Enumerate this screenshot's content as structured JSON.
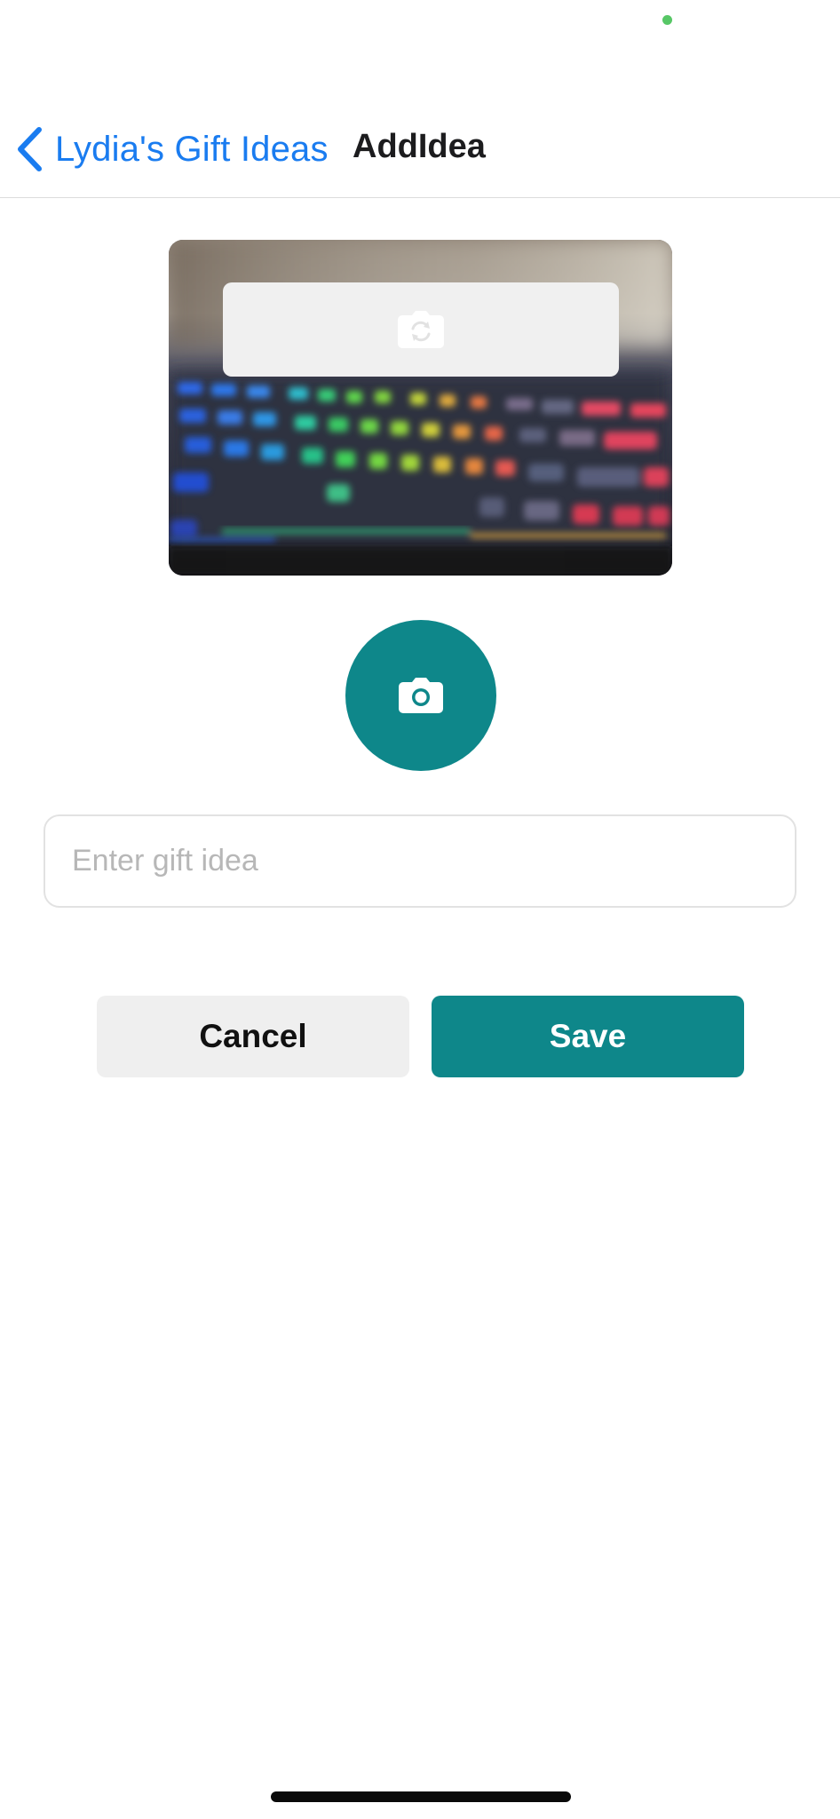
{
  "nav": {
    "back_label": "Lydia's Gift Ideas",
    "title": "AddIdea"
  },
  "preview": {
    "icons": [
      "camera-rotate-icon"
    ]
  },
  "camera_button": {
    "icon": "camera-icon"
  },
  "form": {
    "idea_placeholder": "Enter gift idea",
    "idea_value": ""
  },
  "actions": {
    "cancel_label": "Cancel",
    "save_label": "Save"
  },
  "colors": {
    "accent": "#0e878a",
    "link": "#1a7cf0",
    "status_dot": "#57c766"
  }
}
